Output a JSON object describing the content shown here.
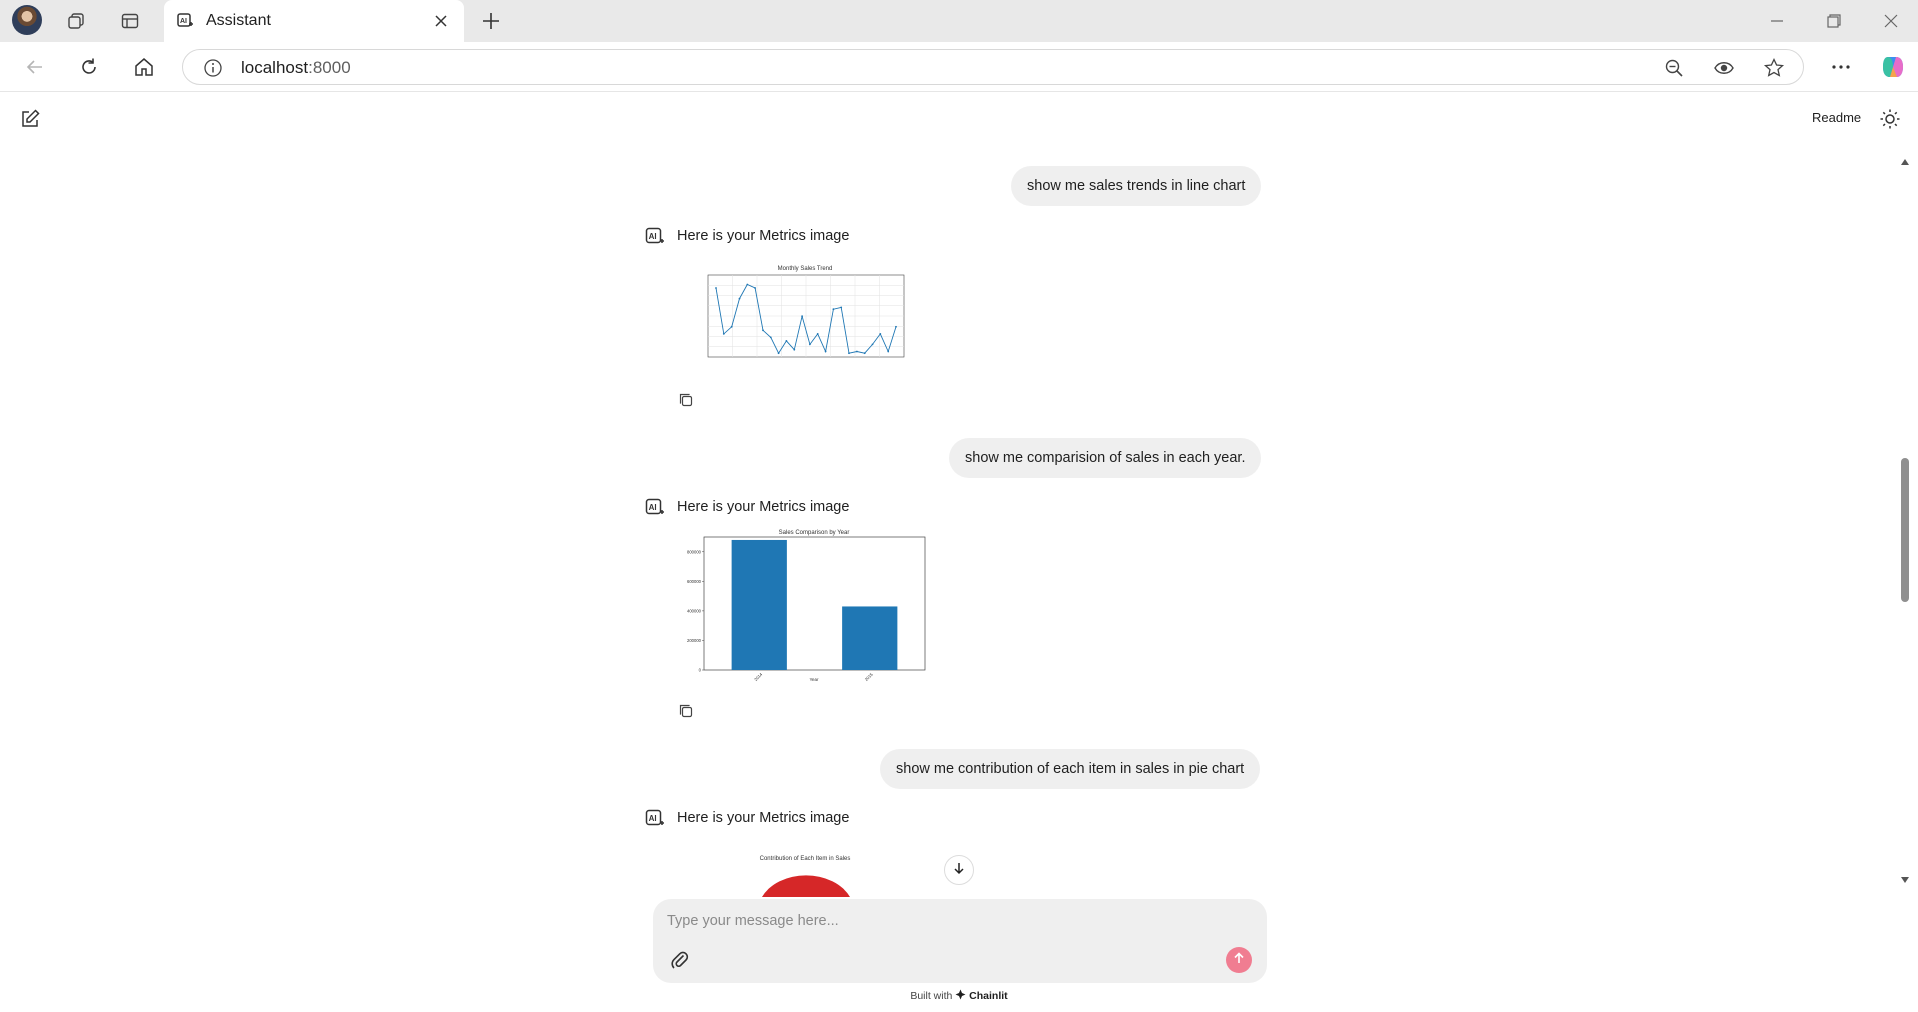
{
  "browser": {
    "tab_title": "Assistant",
    "url_host": "localhost",
    "url_port": ":8000"
  },
  "app": {
    "readme_label": "Readme"
  },
  "messages": {
    "user_1": "show me sales trends in line chart",
    "bot_1": "Here is your Metrics image",
    "user_2": "show me comparision of sales in each year.",
    "bot_2": "Here is your Metrics image",
    "user_3": "show me contribution of each item in sales in pie chart",
    "bot_3": "Here is your Metrics image"
  },
  "composer": {
    "placeholder": "Type your message here..."
  },
  "footer": {
    "built_with": "Built with",
    "brand": "Chainlit"
  },
  "colors": {
    "accent_send": "#f07d91",
    "bar": "#1f77b4",
    "pie_red": "#d62728"
  },
  "chart_data": [
    {
      "type": "line",
      "title": "Monthly Sales Trend",
      "values": [
        190000,
        60000,
        80000,
        160000,
        200000,
        190000,
        70000,
        50000,
        5000,
        40000,
        15000,
        110000,
        30000,
        60000,
        10000,
        130000,
        135000,
        5000,
        10000,
        5000,
        30000,
        60000,
        10000,
        80000
      ]
    },
    {
      "type": "bar",
      "title": "Sales Comparison by Year",
      "categories": [
        "2014",
        "2015"
      ],
      "values": [
        880000,
        430000
      ],
      "ylim": [
        0,
        900000
      ],
      "yticks": [
        "0",
        "200000",
        "400000",
        "600000",
        "800000"
      ],
      "xlabel": "Year"
    },
    {
      "type": "pie",
      "title": "Contribution of Each Item in Sales"
    }
  ]
}
